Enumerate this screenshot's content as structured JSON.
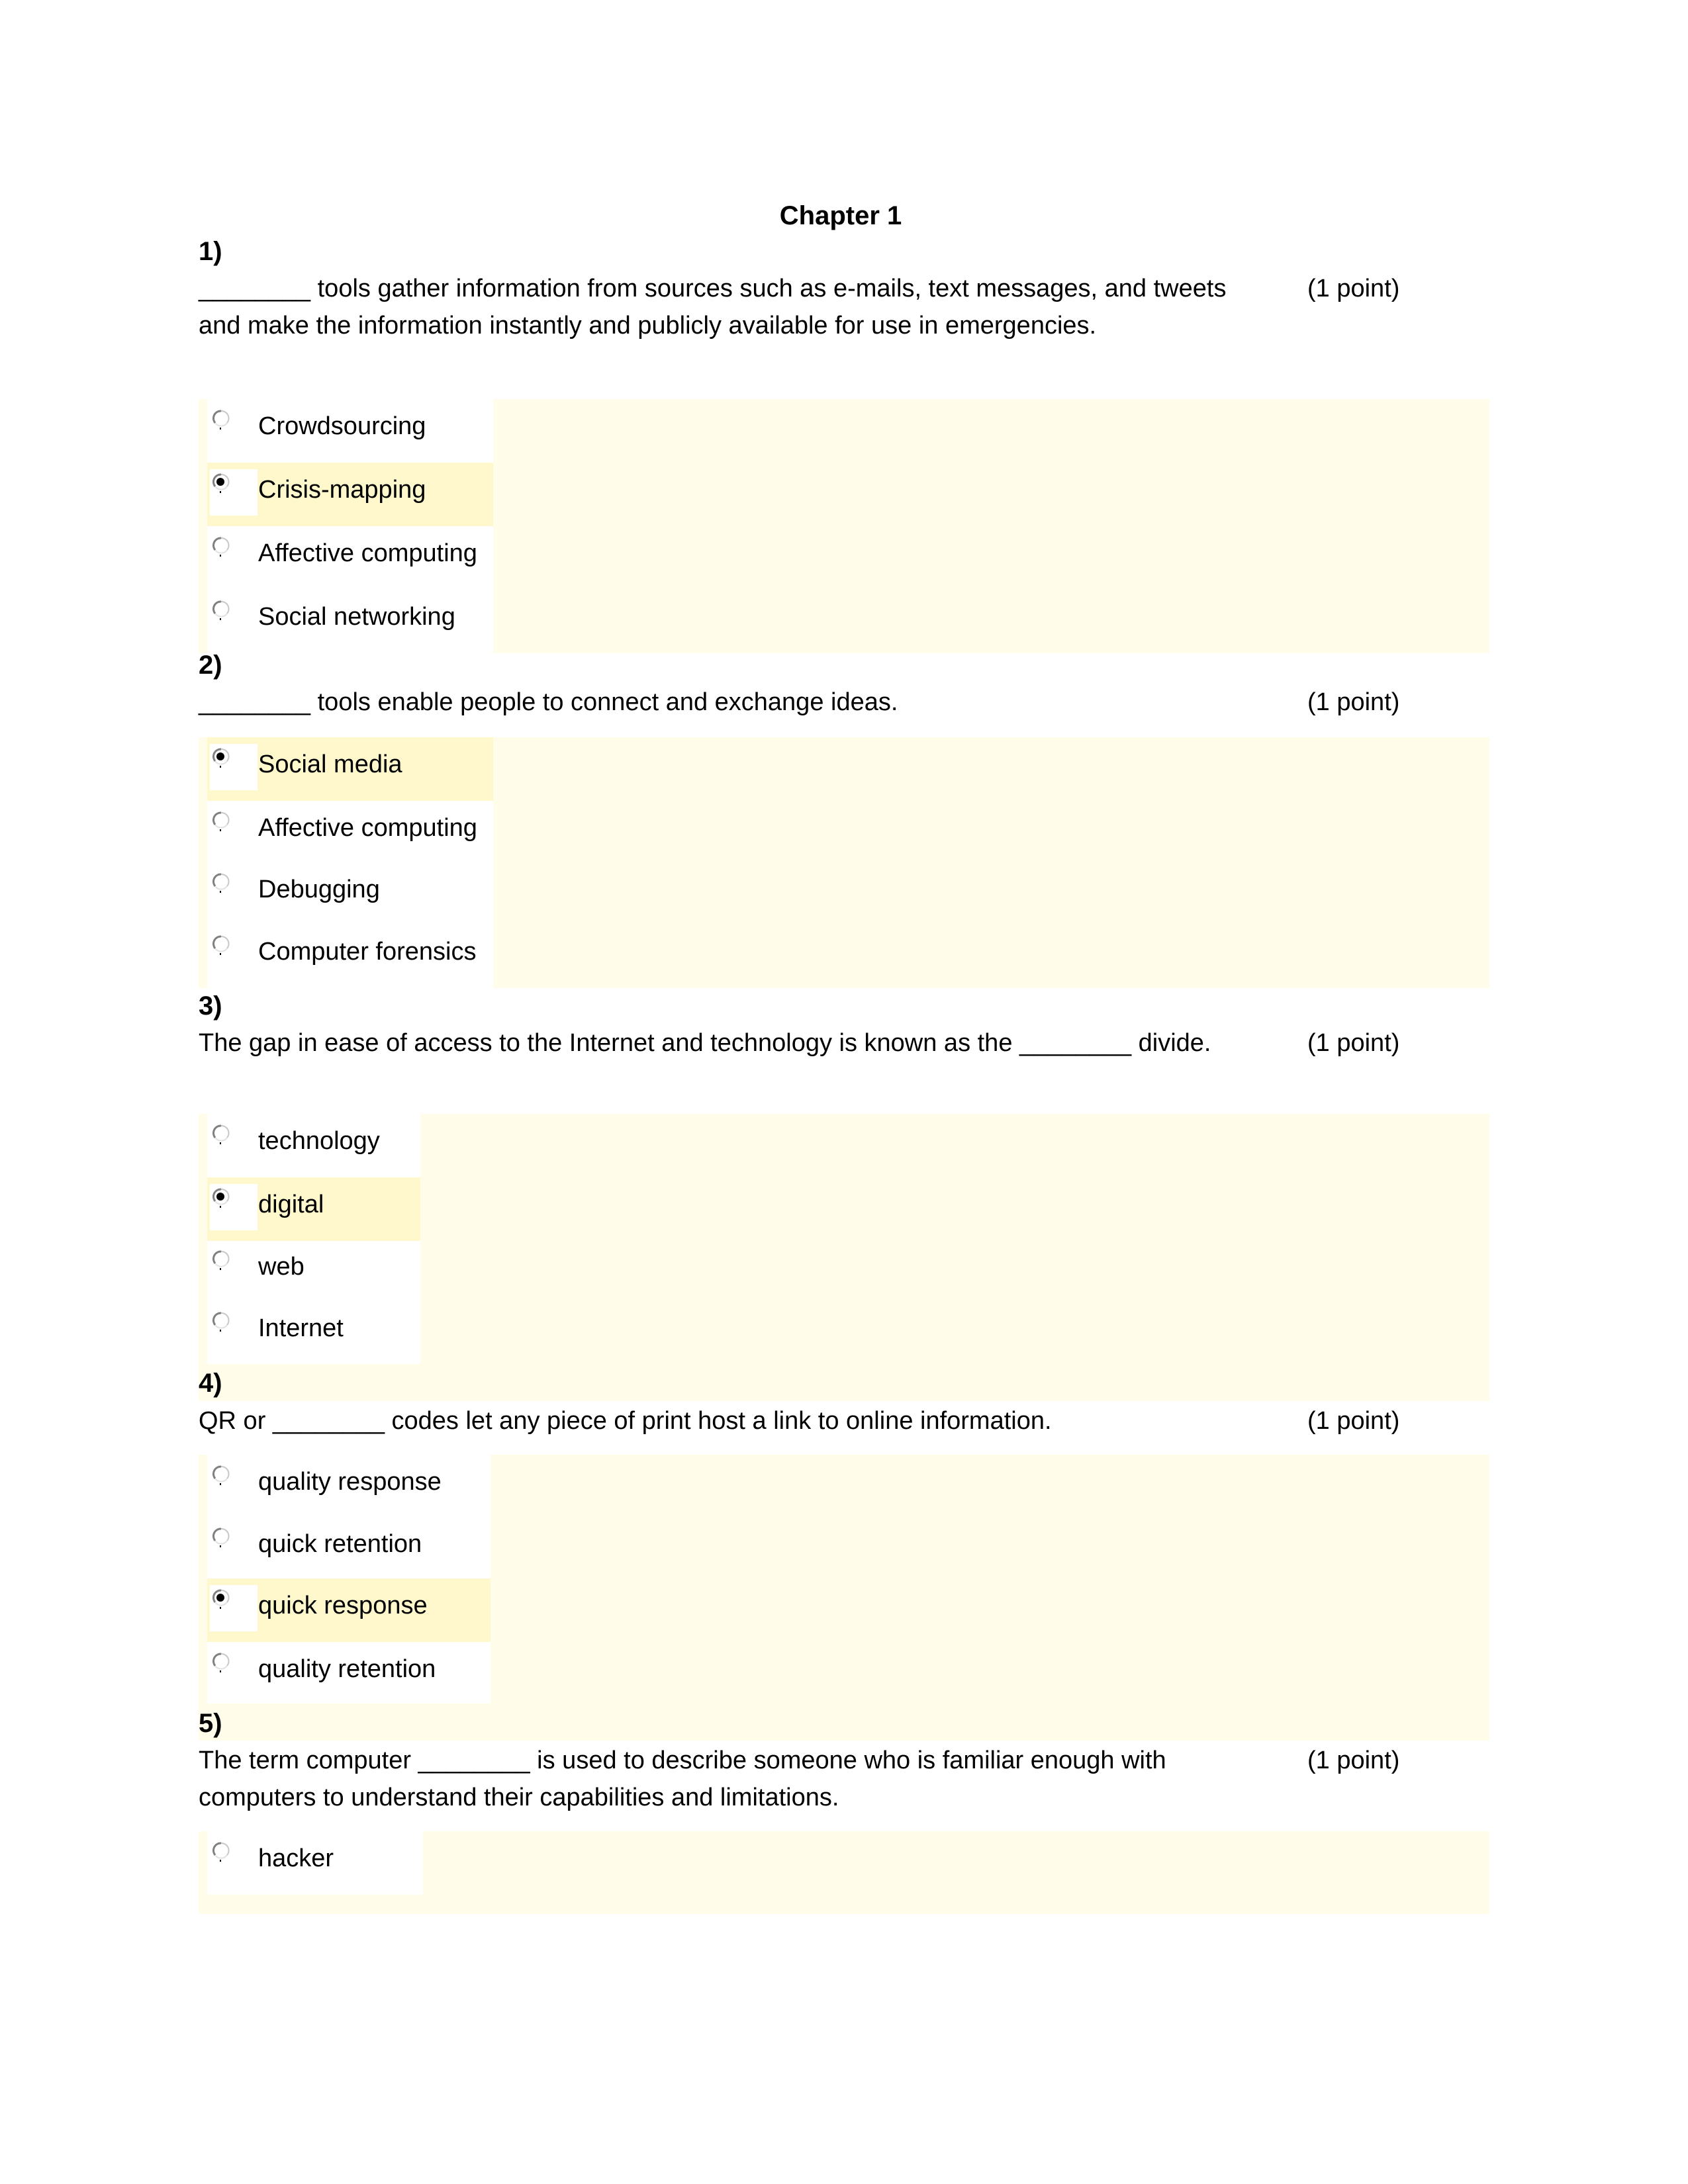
{
  "document": {
    "title": "Chapter 1"
  },
  "colors": {
    "answer_panel": "#FFFCEA",
    "selected_highlight": "#FFF8CC",
    "radio_ring": "#808080",
    "radio_dot": "#000000"
  },
  "questions": [
    {
      "number": "1)",
      "text": "________ tools gather information from sources such as e-mails, text messages, and tweets and make the information instantly and publicly available for use in emergencies.",
      "points": "(1 point)",
      "options": [
        {
          "label": "Crowdsourcing",
          "selected": false
        },
        {
          "label": "Crisis-mapping",
          "selected": true
        },
        {
          "label": "Affective computing",
          "selected": false
        },
        {
          "label": "Social networking",
          "selected": false
        }
      ]
    },
    {
      "number": "2)",
      "text": "________ tools enable people to connect and exchange ideas.",
      "points": "(1 point)",
      "options": [
        {
          "label": "Social media",
          "selected": true
        },
        {
          "label": "Affective computing",
          "selected": false
        },
        {
          "label": "Debugging",
          "selected": false
        },
        {
          "label": "Computer forensics",
          "selected": false
        }
      ]
    },
    {
      "number": "3)",
      "text": "The gap in ease of access to the Internet and technology is known as the ________ divide.",
      "points": "(1 point)",
      "options": [
        {
          "label": "technology",
          "selected": false
        },
        {
          "label": "digital",
          "selected": true
        },
        {
          "label": "web",
          "selected": false
        },
        {
          "label": "Internet",
          "selected": false
        }
      ]
    },
    {
      "number": "4)",
      "text": "QR or ________ codes let any piece of print host a link to online information.",
      "points": "(1 point)",
      "options": [
        {
          "label": "quality response",
          "selected": false
        },
        {
          "label": "quick retention",
          "selected": false
        },
        {
          "label": "quick response",
          "selected": true
        },
        {
          "label": "quality retention",
          "selected": false
        }
      ]
    },
    {
      "number": "5)",
      "text": "The term computer ________ is used to describe someone who is familiar enough with computers to understand their capabilities and limitations.",
      "points": "(1 point)",
      "options": [
        {
          "label": "hacker",
          "selected": false
        }
      ]
    }
  ]
}
